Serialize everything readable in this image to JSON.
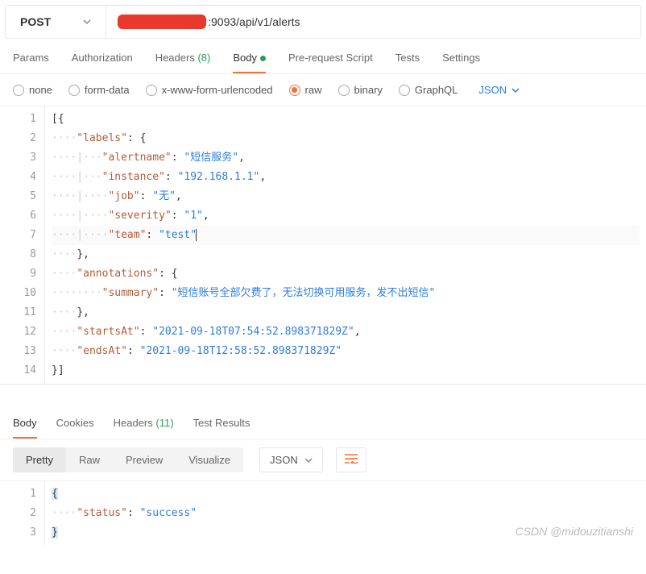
{
  "method": "POST",
  "url_suffix": ":9093/api/v1/alerts",
  "tabs": {
    "params": "Params",
    "auth": "Authorization",
    "headers": "Headers",
    "headers_count": "(8)",
    "body": "Body",
    "prescript": "Pre-request Script",
    "tests": "Tests",
    "settings": "Settings"
  },
  "body_types": {
    "none": "none",
    "formdata": "form-data",
    "urlenc": "x-www-form-urlencoded",
    "raw": "raw",
    "binary": "binary",
    "graphql": "GraphQL",
    "json": "JSON"
  },
  "req": {
    "l1": "[{",
    "labels_key": "\"labels\"",
    "alertname_key": "\"alertname\"",
    "alertname_val": "\"短信服务\"",
    "instance_key": "\"instance\"",
    "instance_val": "\"192.168.1.1\"",
    "job_key": "\"job\"",
    "job_val": "\"无\"",
    "severity_key": "\"severity\"",
    "severity_val": "\"1\"",
    "team_key": "\"team\"",
    "team_val": "\"test\"",
    "annotations_key": "\"annotations\"",
    "summary_key": "\"summary\"",
    "summary_val": "\"短信账号全部欠费了，无法切换可用服务，发不出短信\"",
    "startsAt_key": "\"startsAt\"",
    "startsAt_val": "\"2021-09-18T07:54:52.898371829Z\"",
    "endsAt_key": "\"endsAt\"",
    "endsAt_val": "\"2021-09-18T12:58:52.898371829Z\"",
    "close": "}]"
  },
  "resp_tabs": {
    "body": "Body",
    "cookies": "Cookies",
    "headers": "Headers",
    "headers_count": "(11)",
    "tests": "Test Results"
  },
  "resp_view": {
    "pretty": "Pretty",
    "raw": "Raw",
    "preview": "Preview",
    "visualize": "Visualize",
    "format": "JSON"
  },
  "resp": {
    "open": "{",
    "status_key": "\"status\"",
    "status_val": "\"success\"",
    "close": "}"
  },
  "watermark": "CSDN @midouzitianshi"
}
